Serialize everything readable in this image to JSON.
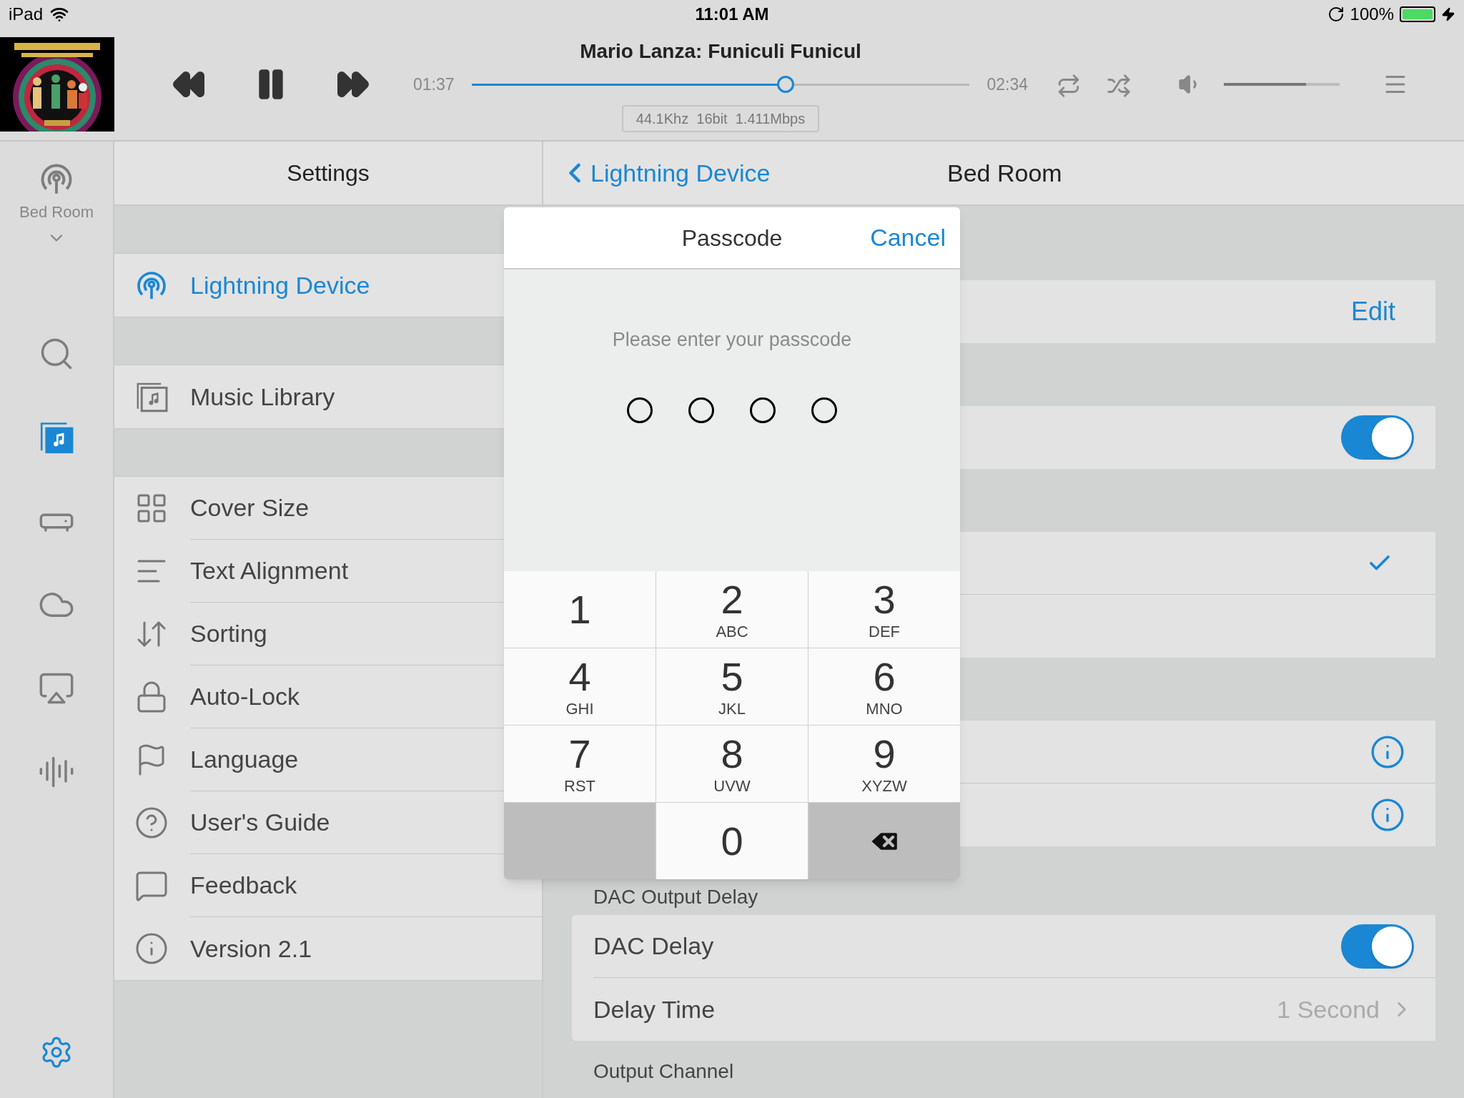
{
  "status_bar": {
    "device": "iPad",
    "time": "11:01 AM",
    "battery": "100%"
  },
  "player": {
    "title": "Mario Lanza: Funiculi Funicul",
    "playing": true,
    "elapsed": "01:37",
    "remaining": "02:34",
    "progress": {
      "level": 0.63
    },
    "format": "44.1Khz  16bit  1.411Mbps",
    "volume": {
      "level": 0.71
    }
  },
  "rail": {
    "zone": "Bed Room",
    "items": [
      {
        "kind": "search",
        "selected": false
      },
      {
        "kind": "library",
        "selected": true
      },
      {
        "kind": "radio",
        "selected": false
      },
      {
        "kind": "cloud",
        "selected": false
      },
      {
        "kind": "airplay",
        "selected": false
      },
      {
        "kind": "stream",
        "selected": false
      }
    ],
    "settings_selected": true
  },
  "settings": {
    "title": "Settings",
    "sections": [
      [
        {
          "kind": "device",
          "label": "Lightning Device",
          "selected": true
        }
      ],
      [
        {
          "kind": "library",
          "label": "Music Library",
          "selected": false
        }
      ],
      [
        {
          "kind": "grid",
          "label": "Cover Size",
          "selected": false
        },
        {
          "kind": "align",
          "label": "Text Alignment",
          "selected": false
        },
        {
          "kind": "sort",
          "label": "Sorting",
          "selected": false
        },
        {
          "kind": "lock",
          "label": "Auto-Lock",
          "selected": false
        },
        {
          "kind": "flag",
          "label": "Language",
          "selected": false
        },
        {
          "kind": "help",
          "label": "User's Guide",
          "selected": false
        },
        {
          "kind": "feedback",
          "label": "Feedback",
          "selected": false
        },
        {
          "kind": "info",
          "label": "Version 2.1",
          "selected": false
        }
      ]
    ]
  },
  "detail": {
    "back": "Lightning Device",
    "title": "Bed Room",
    "groups": [
      {
        "rows": [
          {
            "kind": "action",
            "text": "Edit"
          }
        ]
      },
      {
        "rows": [
          {
            "kind": "toggle",
            "on": true
          }
        ]
      },
      {
        "rows": [
          {
            "kind": "check",
            "checked": true
          },
          {
            "kind": "check",
            "checked": false
          }
        ]
      },
      {
        "rows": [
          {
            "kind": "info"
          },
          {
            "kind": "info"
          }
        ]
      },
      {
        "header": "DAC Output Delay",
        "rows": [
          {
            "kind": "toggle",
            "label": "DAC Delay",
            "on": true
          },
          {
            "kind": "value",
            "label": "Delay Time",
            "value": "1 Second"
          }
        ]
      },
      {
        "header": "Output Channel"
      }
    ]
  },
  "passcode": {
    "title": "Passcode",
    "cancel": "Cancel",
    "prompt": "Please enter your passcode",
    "dots": [
      {
        "filled": false
      },
      {
        "filled": false
      },
      {
        "filled": false
      },
      {
        "filled": false
      }
    ],
    "keys": [
      {
        "kind": "digit",
        "digit": "1"
      },
      {
        "kind": "digit",
        "digit": "2",
        "letters": "ABC"
      },
      {
        "kind": "digit",
        "digit": "3",
        "letters": "DEF"
      },
      {
        "kind": "digit",
        "digit": "4",
        "letters": "GHI"
      },
      {
        "kind": "digit",
        "digit": "5",
        "letters": "JKL"
      },
      {
        "kind": "digit",
        "digit": "6",
        "letters": "MNO"
      },
      {
        "kind": "digit",
        "digit": "7",
        "letters": "RST"
      },
      {
        "kind": "digit",
        "digit": "8",
        "letters": "UVW"
      },
      {
        "kind": "digit",
        "digit": "9",
        "letters": "XYZW"
      },
      {
        "kind": "blank"
      },
      {
        "kind": "digit",
        "digit": "0"
      },
      {
        "kind": "delete"
      }
    ]
  }
}
